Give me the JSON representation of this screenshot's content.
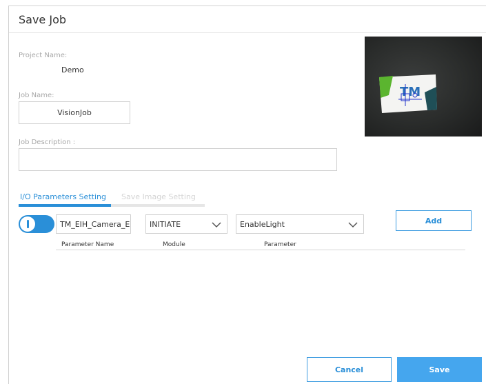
{
  "dialog": {
    "title": "Save Job"
  },
  "form": {
    "project_name_label": "Project Name:",
    "project_name_value": "Demo",
    "job_name_label": "Job Name:",
    "job_name_value": "VisionJob",
    "job_description_label": "Job Description :",
    "job_description_value": ""
  },
  "preview": {
    "logo_text": "TM"
  },
  "tabs": [
    {
      "label": "I/O Parameters Setting",
      "active": true
    },
    {
      "label": "Save Image Setting",
      "active": false
    }
  ],
  "io_row": {
    "toggle_on": true,
    "parameter_name_value": "TM_EIH_Camera_Er",
    "module_value": "INITIATE",
    "parameter_value": "EnableLight",
    "add_label": "Add"
  },
  "table": {
    "columns": [
      "Parameter Name",
      "Module",
      "Parameter"
    ],
    "rows": []
  },
  "footer": {
    "cancel_label": "Cancel",
    "save_label": "Save"
  },
  "colors": {
    "accent": "#2a8fd8",
    "primary_button": "#45a6ee"
  }
}
